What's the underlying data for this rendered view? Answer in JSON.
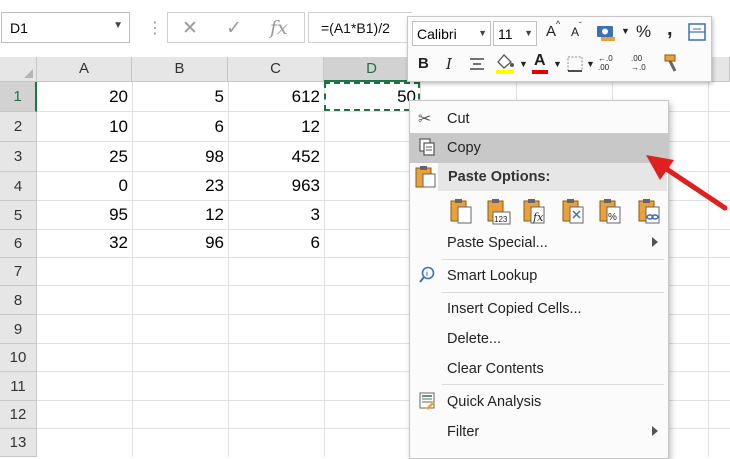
{
  "formula_bar": {
    "name_box": "D1",
    "cancel_icon": "✕",
    "enter_icon": "✓",
    "fx_label": "fx",
    "formula": "=(A1*B1)/2"
  },
  "sheet": {
    "columns": [
      "A",
      "B",
      "C",
      "D"
    ],
    "rows": [
      "1",
      "2",
      "3",
      "4",
      "5",
      "6",
      "7",
      "8",
      "9",
      "10",
      "11",
      "12",
      "13"
    ],
    "data": [
      [
        "20",
        "5",
        "612",
        "50"
      ],
      [
        "10",
        "6",
        "12",
        ""
      ],
      [
        "25",
        "98",
        "452",
        ""
      ],
      [
        "0",
        "23",
        "963",
        ""
      ],
      [
        "95",
        "12",
        "3",
        ""
      ],
      [
        "32",
        "96",
        "6",
        ""
      ]
    ],
    "selected_cell": "D1"
  },
  "mini_toolbar": {
    "font": "Calibri",
    "size": "11",
    "grow": "A",
    "shrink": "A",
    "percent": "%",
    "comma": ",",
    "bold": "B",
    "italic": "I",
    "font_color_letter": "A",
    "increase_dec": "←.0\n.00",
    "decrease_dec": ".00\n→.0"
  },
  "context_menu": {
    "items": {
      "cut": "Cut",
      "copy": "Copy",
      "paste_options": "Paste Options:",
      "paste_special": "Paste Special...",
      "smart_lookup": "Smart Lookup",
      "insert_copied": "Insert Copied Cells...",
      "delete": "Delete...",
      "clear_contents": "Clear Contents",
      "quick_analysis": "Quick Analysis",
      "filter": "Filter"
    },
    "highlighted": "copy"
  },
  "colors": {
    "excel_green": "#217346",
    "arrow_red": "#e02020",
    "highlight": "#c8c8c8"
  }
}
